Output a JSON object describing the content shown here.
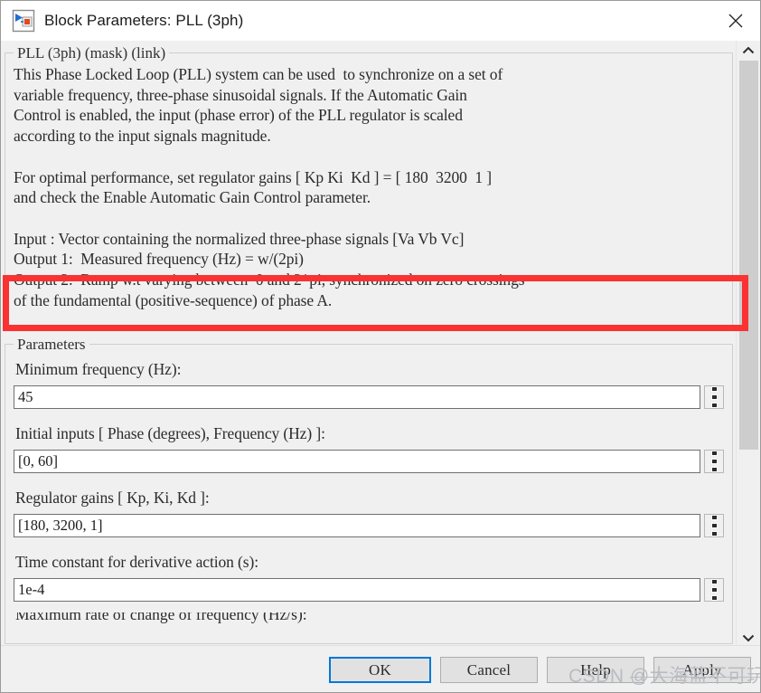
{
  "window": {
    "title": "Block Parameters: PLL (3ph)",
    "icon": "simulink-block-icon",
    "close_icon": "close-icon"
  },
  "description": {
    "legend": "PLL (3ph) (mask) (link)",
    "body": "This Phase Locked Loop (PLL) system can be used  to synchronize on a set of\nvariable frequency, three-phase sinusoidal signals. If the Automatic Gain\nControl is enabled, the input (phase error) of the PLL regulator is scaled\naccording to the input signals magnitude.\n\nFor optimal performance, set regulator gains [ Kp Ki  Kd ] = [ 180  3200  1 ]\nand check the Enable Automatic Gain Control parameter.\n\nInput : Vector containing the normalized three-phase signals [Va Vb Vc]\nOutput 1:  Measured frequency (Hz) = w/(2pi)\nOutput 2:  Ramp w.t varying between  0 and 2*pi, synchronized on zero crossings\nof the fundamental (positive-sequence) of phase A."
  },
  "parameters": {
    "legend": "Parameters",
    "fields": [
      {
        "label": "Minimum frequency (Hz):",
        "value": "45",
        "name": "minimum-frequency"
      },
      {
        "label": "Initial inputs [ Phase (degrees), Frequency (Hz) ]:",
        "value": "[0, 60]",
        "name": "initial-inputs"
      },
      {
        "label": "Regulator gains [ Kp, Ki, Kd ]:",
        "value": "[180, 3200, 1]",
        "name": "regulator-gains"
      },
      {
        "label": "Time constant for derivative action (s):",
        "value": "1e-4",
        "name": "derivative-time-constant"
      }
    ],
    "clipped_label": "Maximum rate of change of frequency (Hz/s):"
  },
  "scrollbar": {
    "up_icon": "chevron-up-icon",
    "down_icon": "chevron-down-icon"
  },
  "annotation": {
    "highlight_color": "#fa3232"
  },
  "buttons": {
    "ok": "OK",
    "cancel": "Cancel",
    "help": "Help",
    "apply": "Apply"
  },
  "watermark": {
    "prefix": "CSDN ",
    "handle": "@大海蓝不可玩啊"
  }
}
